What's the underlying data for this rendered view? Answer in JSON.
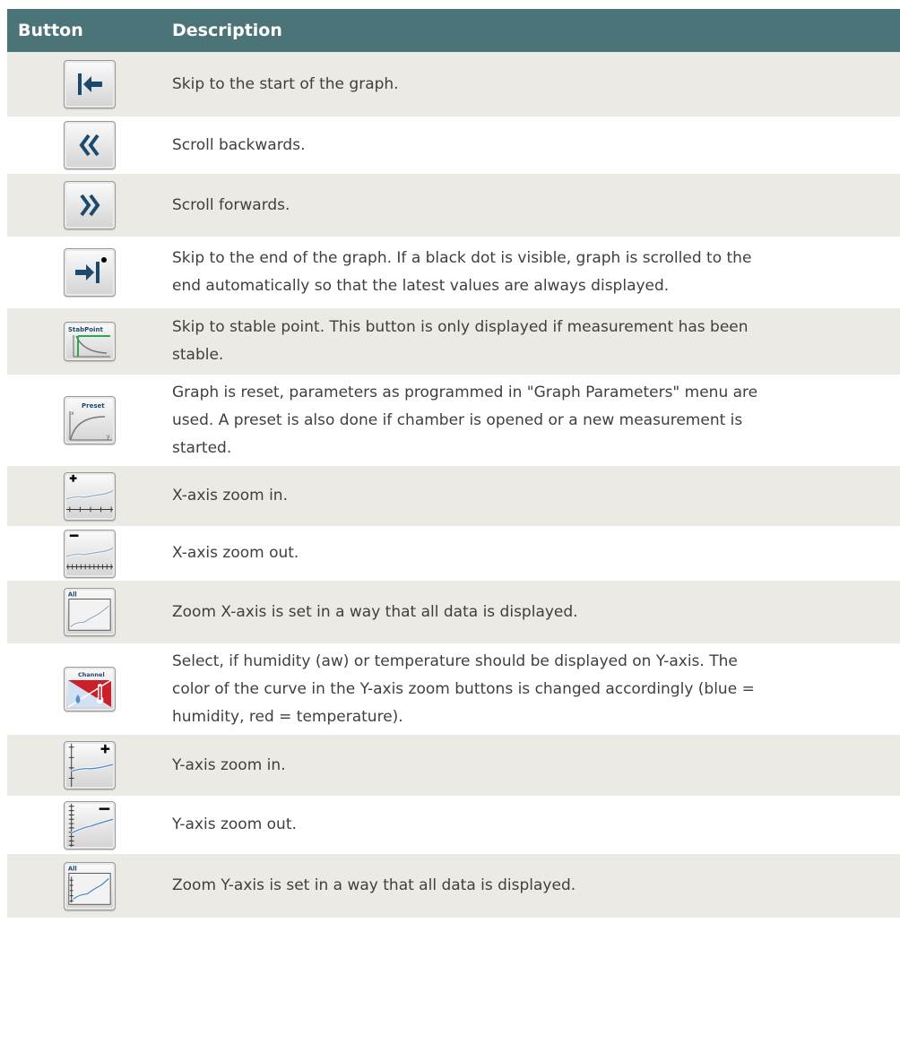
{
  "table": {
    "headers": {
      "button": "Button",
      "description": "Description"
    },
    "rows": [
      {
        "icon": "skip-to-start-icon",
        "description": "Skip to the start of the graph."
      },
      {
        "icon": "scroll-backwards-icon",
        "description": "Scroll backwards."
      },
      {
        "icon": "scroll-forwards-icon",
        "description": "Scroll forwards."
      },
      {
        "icon": "skip-to-end-icon",
        "description_lines": [
          "Skip to the end of the graph. If a black dot is visible, graph is scrolled to the",
          "end automatically so that the latest values are always displayed."
        ]
      },
      {
        "icon": "stable-point-icon",
        "icon_label": "StabPoint",
        "description_lines": [
          "Skip to stable point. This button is only displayed if measurement has been",
          "stable."
        ]
      },
      {
        "icon": "preset-icon",
        "icon_label": "Preset",
        "icon_axis_x": "x",
        "icon_axis_y": "y",
        "description_lines": [
          "Graph is reset, parameters as programmed in \"Graph Parameters\" menu are",
          "used. A preset is also done if chamber is opened or a new measurement is",
          "started."
        ]
      },
      {
        "icon": "x-zoom-in-icon",
        "description": "X-axis zoom in."
      },
      {
        "icon": "x-zoom-out-icon",
        "description": "X-axis zoom out."
      },
      {
        "icon": "x-zoom-all-icon",
        "icon_label": "All",
        "description": "Zoom X-axis is set in a way that all data is displayed."
      },
      {
        "icon": "channel-icon",
        "icon_label": "Channel",
        "description_lines": [
          "Select, if humidity (aw) or temperature should be displayed on Y-axis. The",
          "color of the curve in the Y-axis zoom buttons is changed accordingly (blue =",
          "humidity, red = temperature)."
        ]
      },
      {
        "icon": "y-zoom-in-icon",
        "description": "Y-axis zoom in."
      },
      {
        "icon": "y-zoom-out-icon",
        "description": "Y-axis zoom out."
      },
      {
        "icon": "y-zoom-all-icon",
        "icon_label": "All",
        "description": "Zoom Y-axis is set in a way that all data is displayed."
      }
    ]
  },
  "colors": {
    "header_bg": "#4b7479",
    "row_alt_bg": "#eceae5",
    "icon_accent": "#1b4a6e",
    "curve_blue": "#5a8fc9",
    "temp_red": "#cc1f2a"
  }
}
